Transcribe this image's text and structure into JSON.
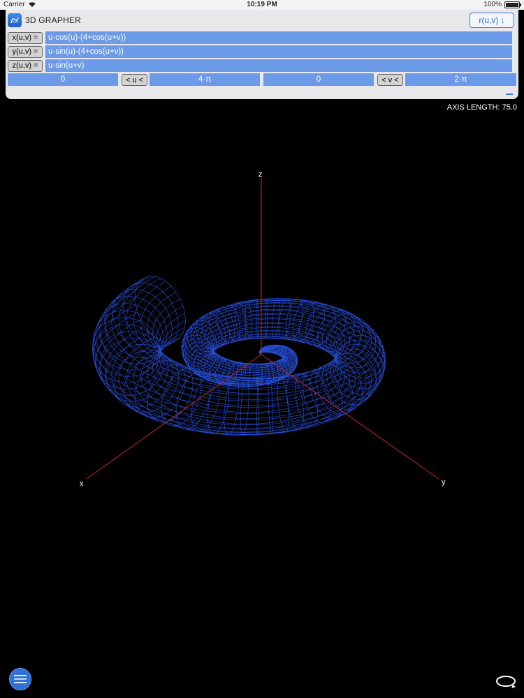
{
  "status": {
    "carrier": "Carrier",
    "time": "10:19 PM",
    "battery": "100%"
  },
  "app": {
    "title": "3D GRAPHER",
    "mode_label": "r(u,v) ↓"
  },
  "equations": [
    {
      "label": "x(u,v) =",
      "value": "u·cos(u)·(4+cos(u+v))"
    },
    {
      "label": "y(u,v) =",
      "value": "u·sin(u)·(4+cos(u+v))"
    },
    {
      "label": "z(u,v) =",
      "value": "u·sin(u+v)"
    }
  ],
  "ranges": {
    "u_min": "0",
    "u_toggle": "< u <",
    "u_max": "4·π",
    "v_min": "0",
    "v_toggle": "< v <",
    "v_max": "2·π"
  },
  "axis_length_text": "AXIS LENGTH: 75.0",
  "axes": {
    "x": "x",
    "y": "y",
    "z": "z"
  },
  "colors": {
    "surface": "#2b5cff",
    "axis": "#c0242b",
    "field": "#6b9ae8",
    "accent": "#3a7de0"
  },
  "icons": {
    "menu": "menu-icon",
    "rotate": "rotate-icon",
    "app": "app-icon"
  }
}
